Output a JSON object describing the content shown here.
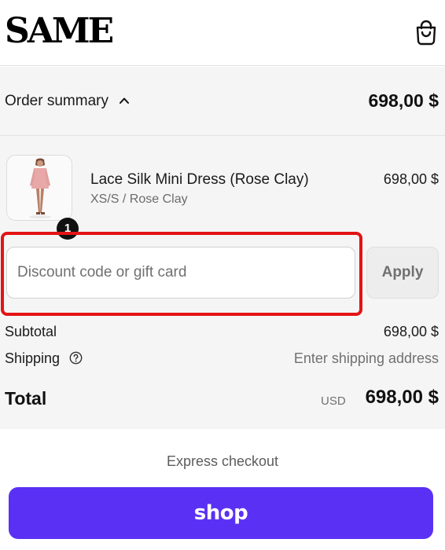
{
  "header": {
    "logo": "SAME",
    "cart_icon": "shopping-bag-icon"
  },
  "summary": {
    "toggle_label": "Order summary",
    "toggle_icon": "chevron-up-icon",
    "total": "698,00 $"
  },
  "line_item": {
    "quantity": "1",
    "name": "Lace Silk Mini Dress (Rose Clay)",
    "variant": "XS/S / Rose Clay",
    "price": "698,00 $"
  },
  "discount": {
    "placeholder": "Discount code or gift card",
    "value": "",
    "apply_label": "Apply",
    "highlight_color": "#e31414"
  },
  "totals": {
    "subtotal_label": "Subtotal",
    "subtotal_value": "698,00 $",
    "shipping_label": "Shipping",
    "shipping_help_icon": "help-circle-icon",
    "shipping_value": "Enter shipping address",
    "total_label": "Total",
    "currency": "USD",
    "total_value": "698,00 $"
  },
  "express": {
    "label": "Express checkout",
    "shop_pay_label": "shop",
    "shop_pay_color": "#5a31f4"
  }
}
